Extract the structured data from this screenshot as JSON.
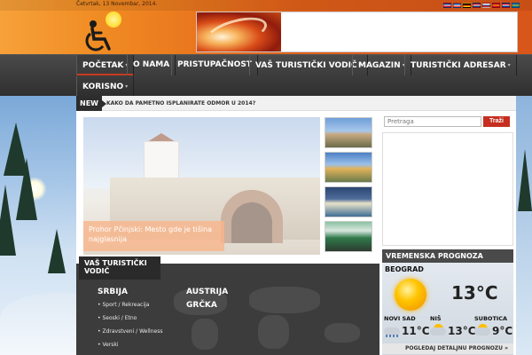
{
  "header": {
    "date": "Četvrtak, 13 Novembar, 2014.",
    "flags": [
      {
        "colors": [
          "#1f3f8f",
          "#ffffff",
          "#c8102e"
        ]
      },
      {
        "colors": [
          "#0055a4",
          "#ffffff",
          "#ef4135"
        ]
      },
      {
        "colors": [
          "#000000",
          "#dd0000",
          "#ffce00"
        ]
      },
      {
        "colors": [
          "#c8102e",
          "#ffffff",
          "#0c4076"
        ]
      },
      {
        "colors": [
          "#ffffff",
          "#0039a6",
          "#d52b1e"
        ]
      },
      {
        "colors": [
          "#c60b1e",
          "#ffc400",
          "#c60b1e"
        ]
      },
      {
        "colors": [
          "#c8102e",
          "#ffffff",
          "#003b8f"
        ]
      },
      {
        "colors": [
          "#006aa7",
          "#fecc00",
          "#006aa7"
        ]
      }
    ]
  },
  "nav": {
    "items": [
      {
        "label": "POČETAK",
        "dropdown": true,
        "active": true
      },
      {
        "label": "O NAMA",
        "dropdown": false
      },
      {
        "label": "PRISTUPAČNOST",
        "dropdown": false
      },
      {
        "label": "VAŠ TURISTIČKI VODIČ",
        "dropdown": true
      },
      {
        "label": "MAGAZIN",
        "dropdown": true
      },
      {
        "label": "TURISTIČKI ADRESAR",
        "dropdown": true
      },
      {
        "label": "KORISNO",
        "dropdown": true
      }
    ]
  },
  "ticker": {
    "badge": "NEW",
    "headline": "KAKO DA PAMETNO ISPLANIRATE ODMOR U 2014?"
  },
  "slider": {
    "caption": "Prohor Pčinjski: Mesto gde je tišina najglasnija"
  },
  "guide": {
    "title": "VAŠ TURISTIČKI VODIČ",
    "countries": [
      "SRBIJA",
      "AUSTRIJA",
      "GRČKA"
    ],
    "serbia_links": [
      "Sport / Rekreacija",
      "Seoski / Etno",
      "Zdravstveni / Wellness",
      "Verski"
    ]
  },
  "sidebar": {
    "search_placeholder": "Pretraga",
    "search_button": "Traži",
    "weather": {
      "title": "VREMENSKA PROGNOZA",
      "main_city": "BEOGRAD",
      "main_temp": "13°C",
      "main_icon": "sun-icon",
      "cities": [
        {
          "name": "NOVI SAD",
          "temp": "11°C",
          "icon": "rain-icon"
        },
        {
          "name": "NIŠ",
          "temp": "13°C",
          "icon": "partly-cloudy-icon"
        },
        {
          "name": "SUBOTICA",
          "temp": "9°C",
          "icon": "partly-cloudy-icon"
        }
      ],
      "detail_link": "POGLEDAJ DETALJNU PROGNOZU »"
    }
  }
}
